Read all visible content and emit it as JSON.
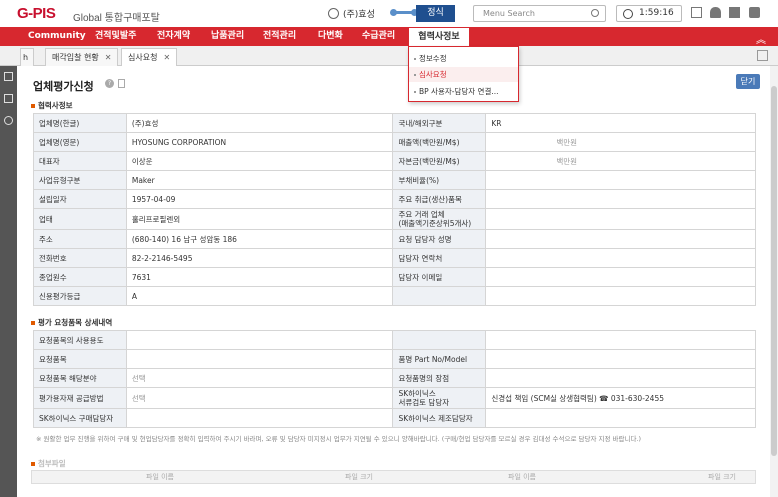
{
  "header": {
    "logo": "G-PIS",
    "logo_sub": "Global 통합구매포탈",
    "user": "(주)효성",
    "official": "정식",
    "search_placeholder": "Menu Search",
    "timer": "1:59:16"
  },
  "menu": {
    "items": [
      "Community",
      "견적및발주",
      "전자계약",
      "납품관리",
      "전적관리",
      "다변화",
      "수급관리",
      "협력사정보"
    ],
    "active": "협력사정보"
  },
  "dropdown": {
    "items": [
      "정보수정",
      "심사요청",
      "BP 사용자-담당자 연결..."
    ],
    "active": "심사요청"
  },
  "tabs": {
    "items": [
      "매각입찰 현황",
      "심사요청"
    ],
    "active": "심사요청"
  },
  "page": {
    "title": "업체평가신청",
    "close_label": "닫기"
  },
  "section1": {
    "title": "협력사정보",
    "rows": [
      [
        "업체명(한글)",
        "(주)효성",
        "국내/해외구분",
        "KR"
      ],
      [
        "업체명(영문)",
        "HYOSUNG CORPORATION",
        "매출액(백만원/M$)",
        "백만원"
      ],
      [
        "대표자",
        "이상운",
        "자본금(백만원/M$)",
        "백만원"
      ],
      [
        "사업유형구분",
        "Maker",
        "부채비율(%)",
        ""
      ],
      [
        "설립일자",
        "1957-04-09",
        "주요 취급(생산)품목",
        ""
      ],
      [
        "업태",
        "홀리프로필렌외",
        "주요 거래 업체\n(매출액기준상위5개사)",
        ""
      ],
      [
        "주소",
        "(680-140) 16 남구 성암동 186",
        "요청 담당자 성명",
        ""
      ],
      [
        "전화번호",
        "82-2-2146-5495",
        "담당자 연락처",
        ""
      ],
      [
        "종업원수",
        "7631",
        "담당자 이메일",
        ""
      ],
      [
        "신용평가등급",
        "A",
        "",
        ""
      ]
    ]
  },
  "section2": {
    "title": "평가 요청품목 상세내역",
    "rows": [
      [
        "요청품목의 사용용도",
        "",
        "",
        ""
      ],
      [
        "요청품목",
        "",
        "품명 Part No/Model",
        ""
      ],
      [
        "요청품목 해당분야",
        "선택",
        "요청품명의 장점",
        ""
      ],
      [
        "평가용자재 공급방법",
        "선택",
        "SK하이닉스\n서류검토 담당자",
        "신경섭 책임 (SCM실 상생협력팀) ☎ 031-630-2455"
      ],
      [
        "SK하이닉스 구매담당자",
        "",
        "SK하이닉스 제조담당자",
        ""
      ]
    ]
  },
  "note": "※ 원활한 업무 진행을 위하여 구매 및 현업담당자를 정확히 입력하여 주시기 바라며, 오류 및 담당자 미지정시 업무가 지연될 수 있으니 양해바랍니다. (구매/현업 담당자를 모르실 경우 김대성 수석으로 담당자 지정 바랍니다.)",
  "files": {
    "title": "첨부파일",
    "columns": [
      "파일 이름",
      "파일 크기",
      "파일 이름",
      "파일 크기"
    ]
  }
}
